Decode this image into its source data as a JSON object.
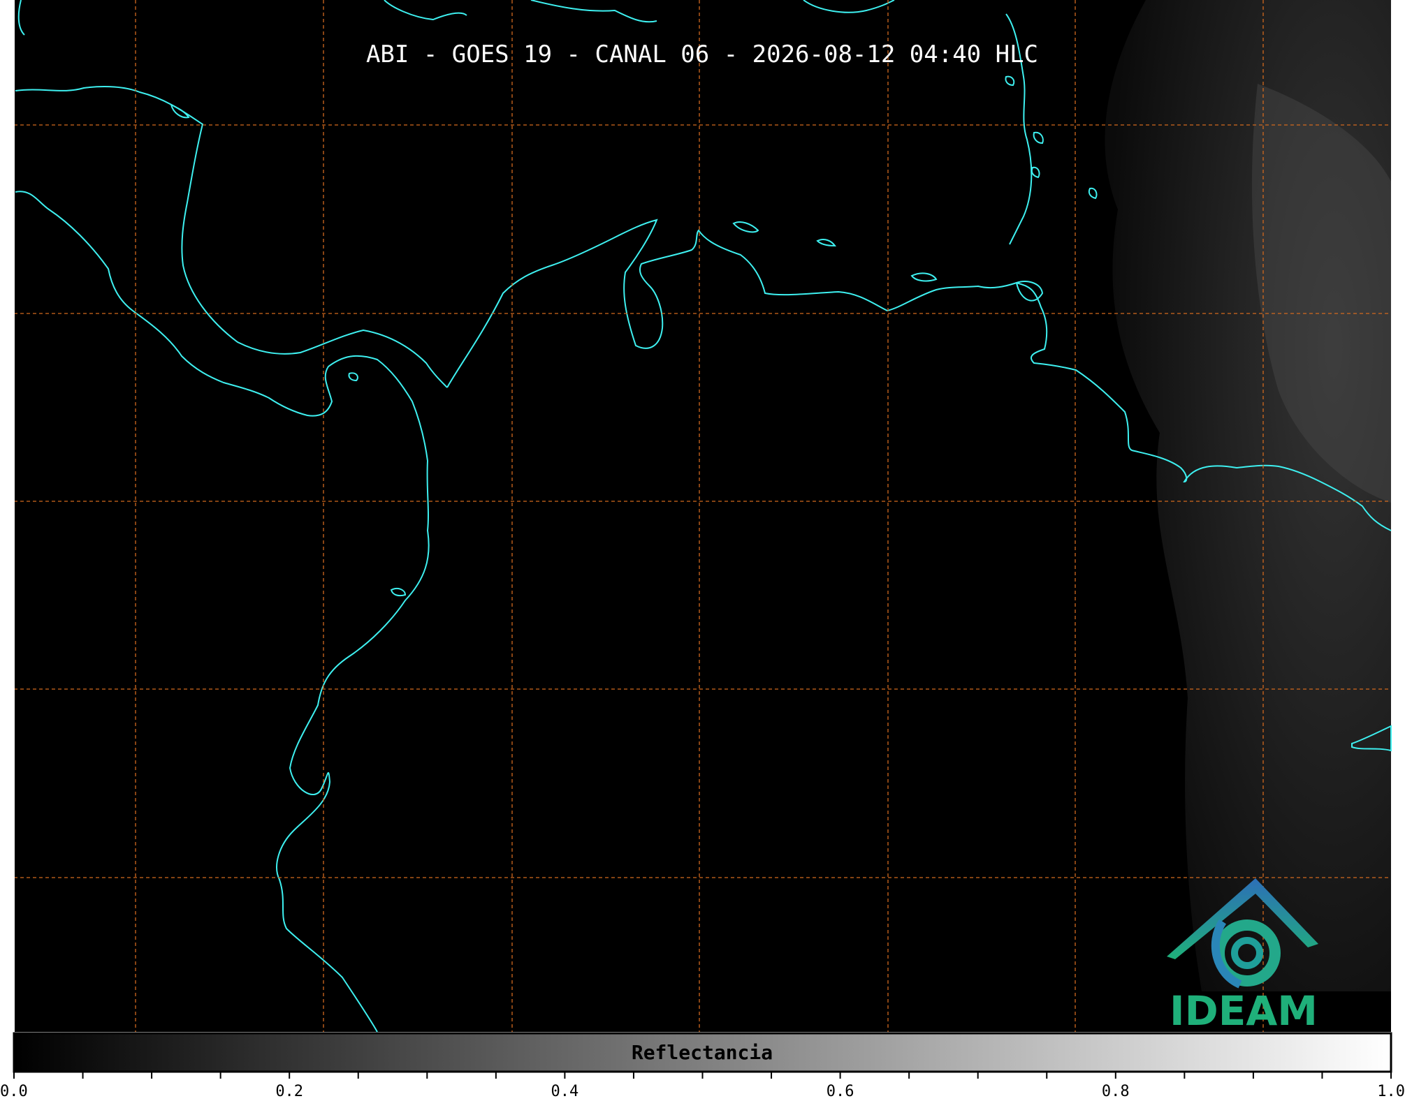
{
  "title": "ABI - GOES 19 - CANAL 06 - 2026-08-12 04:40 HLC",
  "colorbar": {
    "label": "Reflectancia",
    "min": 0.0,
    "max": 1.0,
    "ticks": [
      "0.0",
      "0.2",
      "0.4",
      "0.6",
      "0.8",
      "1.0"
    ],
    "minor_step": 0.05
  },
  "logo": {
    "text": "IDEAM"
  },
  "colors": {
    "background": "#000000",
    "coastline": "#3ef0f0",
    "gridline": "#d2691e",
    "logo_blue": "#2a86b8",
    "logo_green": "#1fb07a"
  },
  "icons": [
    "ideam-logo-icon"
  ]
}
